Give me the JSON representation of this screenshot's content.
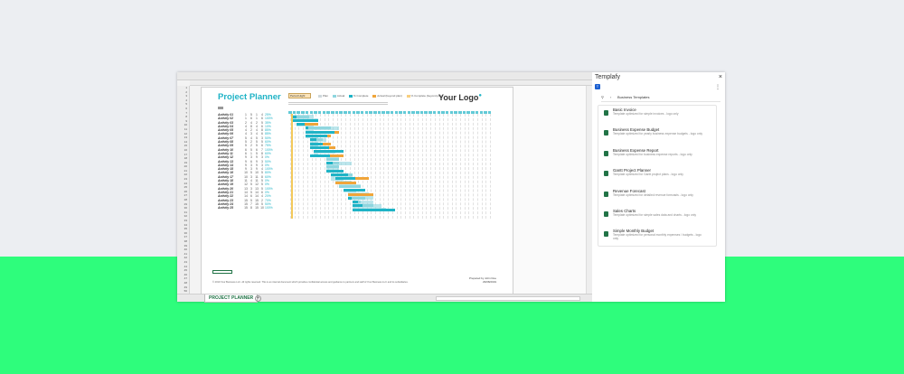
{
  "sheet": {
    "title": "Project Planner",
    "logo": "Your Logo",
    "period_label": "Period Highl",
    "legend": [
      "Plan",
      "Actual",
      "% Complete",
      "Actual (beyond plan)",
      "% Complete (beyond plan)"
    ],
    "activities": [
      {
        "name": "Activity 01",
        "c1": "1",
        "c2": "5",
        "c3": "1",
        "c4": "4",
        "pct": "25%"
      },
      {
        "name": "Activity 02",
        "c1": "1",
        "c2": "6",
        "c3": "1",
        "c4": "6",
        "pct": "100%"
      },
      {
        "name": "Activity 03",
        "c1": "2",
        "c2": "4",
        "c3": "2",
        "c4": "5",
        "pct": "35%"
      },
      {
        "name": "Activity 04",
        "c1": "4",
        "c2": "8",
        "c3": "4",
        "c4": "6",
        "pct": "10%"
      },
      {
        "name": "Activity 05",
        "c1": "4",
        "c2": "2",
        "c3": "4",
        "c4": "8",
        "pct": "85%"
      },
      {
        "name": "Activity 06",
        "c1": "4",
        "c2": "3",
        "c3": "4",
        "c4": "6",
        "pct": "85%"
      },
      {
        "name": "Activity 07",
        "c1": "5",
        "c2": "4",
        "c3": "5",
        "c4": "3",
        "pct": "50%"
      },
      {
        "name": "Activity 08",
        "c1": "5",
        "c2": "2",
        "c3": "5",
        "c4": "5",
        "pct": "60%"
      },
      {
        "name": "Activity 09",
        "c1": "5",
        "c2": "2",
        "c3": "5",
        "c4": "6",
        "pct": "75%"
      },
      {
        "name": "Activity 10",
        "c1": "6",
        "c2": "5",
        "c3": "6",
        "c4": "7",
        "pct": "100%"
      },
      {
        "name": "Activity 11",
        "c1": "6",
        "c2": "1",
        "c3": "5",
        "c4": "8",
        "pct": "60%"
      },
      {
        "name": "Activity 12",
        "c1": "9",
        "c2": "3",
        "c3": "9",
        "c4": "3",
        "pct": "0%"
      },
      {
        "name": "Activity 13",
        "c1": "9",
        "c2": "6",
        "c3": "9",
        "c4": "3",
        "pct": "50%"
      },
      {
        "name": "Activity 14",
        "c1": "9",
        "c2": "3",
        "c3": "9",
        "c4": "3",
        "pct": "0%"
      },
      {
        "name": "Activity 15",
        "c1": "9",
        "c2": "3",
        "c3": "9",
        "c4": "4",
        "pct": "100%"
      },
      {
        "name": "Activity 16",
        "c1": "10",
        "c2": "5",
        "c3": "10",
        "c4": "5",
        "pct": "80%"
      },
      {
        "name": "Activity 17",
        "c1": "10",
        "c2": "3",
        "c3": "11",
        "c4": "8",
        "pct": "60%"
      },
      {
        "name": "Activity 18",
        "c1": "11",
        "c2": "4",
        "c3": "11",
        "c4": "5",
        "pct": "0%"
      },
      {
        "name": "Activity 19",
        "c1": "12",
        "c2": "5",
        "c3": "12",
        "c4": "5",
        "pct": "0%"
      },
      {
        "name": "Activity 20",
        "c1": "13",
        "c2": "3",
        "c3": "13",
        "c4": "5",
        "pct": "100%"
      },
      {
        "name": "Activity 21",
        "c1": "14",
        "c2": "5",
        "c3": "14",
        "c4": "6",
        "pct": "0%"
      },
      {
        "name": "Activity 22",
        "c1": "14",
        "c2": "6",
        "c3": "14",
        "c4": "4",
        "pct": "20%"
      },
      {
        "name": "Activity 23",
        "c1": "15",
        "c2": "5",
        "c3": "15",
        "c4": "2",
        "pct": "70%"
      },
      {
        "name": "Activity 24",
        "c1": "15",
        "c2": "7",
        "c3": "15",
        "c4": "5",
        "pct": "50%"
      },
      {
        "name": "Activity 25",
        "c1": "15",
        "c2": "8",
        "c3": "15",
        "c4": "10",
        "pct": "100%"
      }
    ],
    "footer": "© 2019 Your Business LLC. All rights reserved. This is an internal document which provides confidential access and guidance to partners and staff of Your Business LLC and its subsidiaries.",
    "prepared_by": "Prepared by John Doe",
    "prepared_date": "29/08/2019",
    "tab_label": "PROJECT PLANNER",
    "add_tab": "+"
  },
  "panel": {
    "title": "Templafy",
    "close": "×",
    "breadcrumb": "Business Templates",
    "templates": [
      {
        "name": "Basic Invoice",
        "desc": "Template optimized for simple invoices - logo only"
      },
      {
        "name": "Business Expense Budget",
        "desc": "Template optimized for yearly business expense budgets - logo only"
      },
      {
        "name": "Business Expense Report",
        "desc": "Template optimized for business expense reports - logo only"
      },
      {
        "name": "Gantt Project Planner",
        "desc": "Template optimized for Gantt project plans - logo only"
      },
      {
        "name": "Revenue Forecast",
        "desc": "Template optimized for detailed revenue forecasts - logo only"
      },
      {
        "name": "Sales Charts",
        "desc": "Template optimized for simple sales data and charts - logo only"
      },
      {
        "name": "Simple Monthly Budget",
        "desc": "Template optimized for personal monthly expenses / budgets - logo only"
      }
    ]
  },
  "colors": {
    "teal": "#1fb3c6",
    "lightteal": "#8fd6df",
    "orange": "#f0a53a",
    "excel_green": "#217346",
    "templafy_blue": "#1b5fd1"
  }
}
